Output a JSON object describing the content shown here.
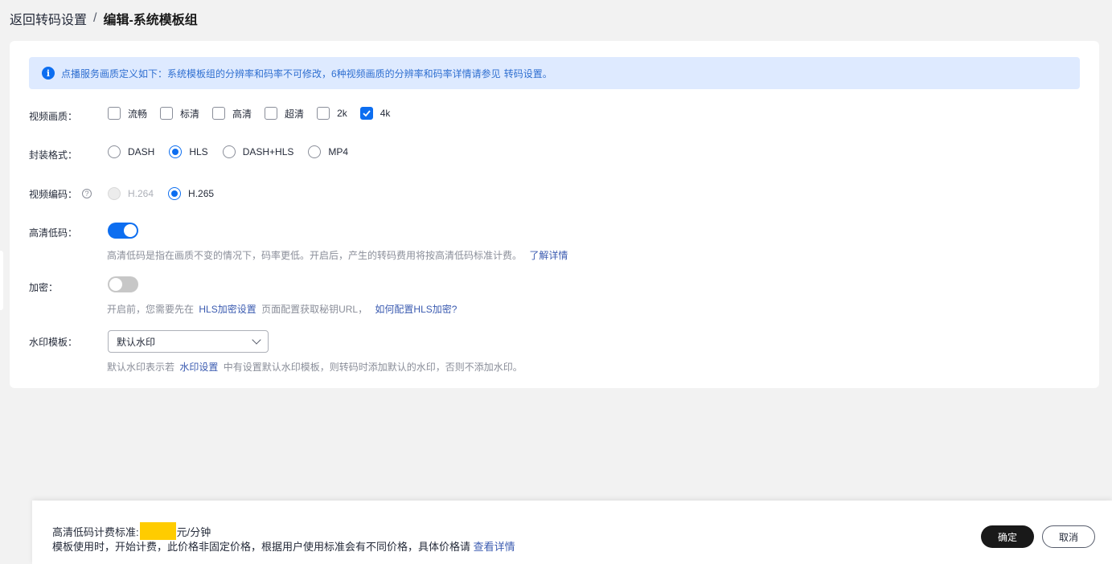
{
  "header": {
    "back": "返回转码设置",
    "separator": "/",
    "title": "编辑-系统模板组"
  },
  "notice": {
    "icon": "info-icon",
    "text": "点播服务画质定义如下：系统模板组的分辨率和码率不可修改，6种视频画质的分辨率和码率详情请参见",
    "link": "转码设置。"
  },
  "quality": {
    "label": "视频画质：",
    "options": [
      {
        "text": "流畅",
        "checked": false
      },
      {
        "text": "标清",
        "checked": false
      },
      {
        "text": "高清",
        "checked": false
      },
      {
        "text": "超清",
        "checked": false
      },
      {
        "text": "2k",
        "checked": false
      },
      {
        "text": "4k",
        "checked": true
      }
    ]
  },
  "format": {
    "label": "封装格式：",
    "options": [
      {
        "text": "DASH",
        "selected": false
      },
      {
        "text": "HLS",
        "selected": true
      },
      {
        "text": "DASH+HLS",
        "selected": false
      },
      {
        "text": "MP4",
        "selected": false
      }
    ]
  },
  "codec": {
    "label": "视频编码：",
    "help": "?",
    "options": [
      {
        "text": "H.264",
        "selected": false,
        "disabled": true
      },
      {
        "text": "H.265",
        "selected": true,
        "disabled": false
      }
    ]
  },
  "hd_low_bitrate": {
    "label": "高清低码：",
    "enabled": true,
    "hint": "高清低码是指在画质不变的情况下，码率更低。开启后，产生的转码费用将按高清低码标准计费。",
    "hint_link": "了解详情"
  },
  "encryption": {
    "label": "加密：",
    "enabled": false,
    "hint_prefix": "开启前，您需要先在",
    "hint_link1": "HLS加密设置",
    "hint_middle": "页面配置获取秘钥URL，",
    "hint_link2": "如何配置HLS加密?"
  },
  "watermark": {
    "label": "水印模板：",
    "selected": "默认水印",
    "hint_prefix": "默认水印表示若",
    "hint_link": "水印设置",
    "hint_suffix": "中有设置默认水印模板，则转码时添加默认的水印，否则不添加水印。"
  },
  "footer": {
    "fee_label": "高清低码计费标准:",
    "fee_unit": "元/分钟",
    "note": "模板使用时，开始计费，此价格非固定价格，根据用户使用标准会有不同价格，具体价格请",
    "note_link": "查看详情",
    "ok": "确定",
    "cancel": "取消"
  }
}
